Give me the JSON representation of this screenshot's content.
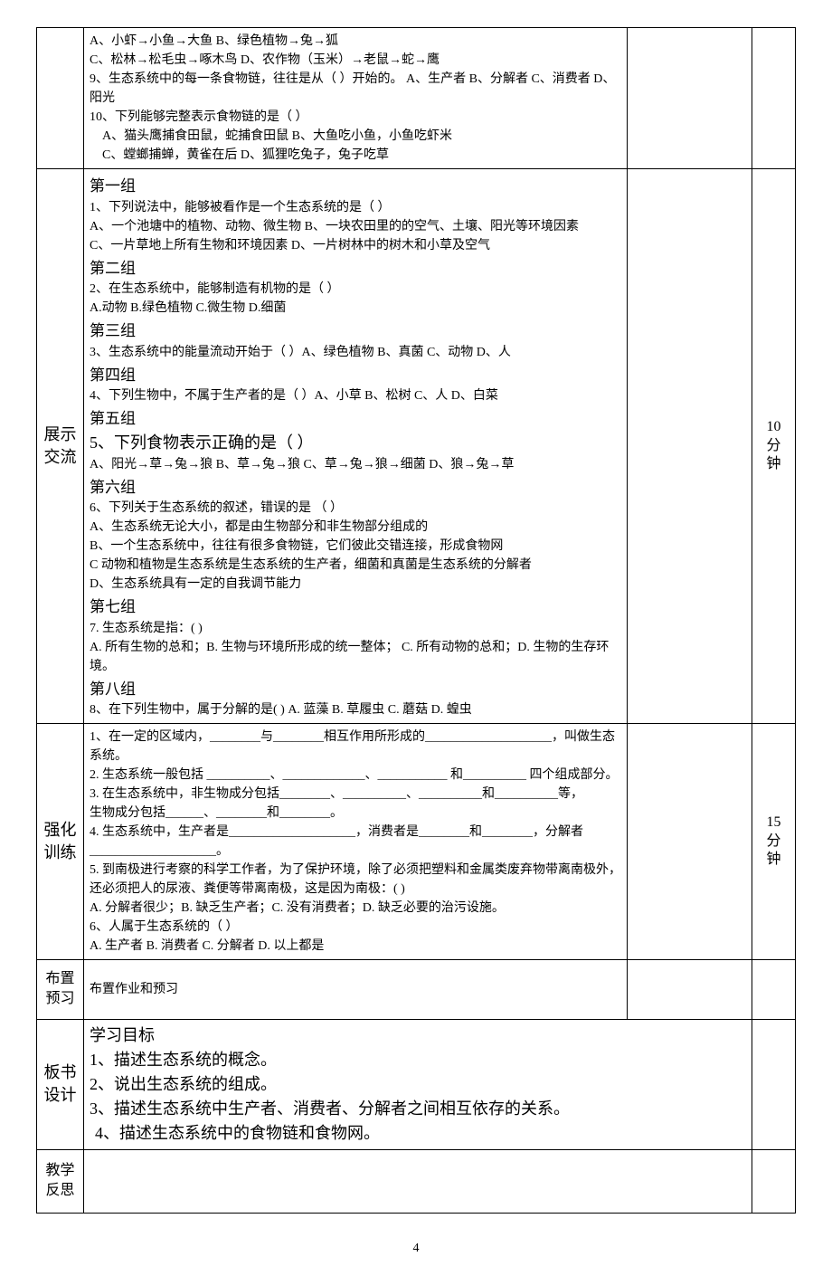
{
  "top_block": {
    "q_a": "A、小虾→小鱼→大鱼  B、绿色植物→兔→狐",
    "q_c": "C、松林→松毛虫→啄木鸟 D、农作物（玉米）→老鼠→蛇→鹰",
    "q9": "9、生态系统中的每一条食物链，往往是从（ ）开始的。   A、生产者   B、分解者   C、消费者   D、阳光",
    "q10_stem": "10、下列能够完整表示食物链的是（ ）",
    "q10_ab": "A、猫头鹰捕食田鼠，蛇捕食田鼠  B、大鱼吃小鱼，小鱼吃虾米",
    "q10_cd": "C、螳螂捕蝉，黄雀在后    D、狐狸吃兔子，兔子吃草"
  },
  "display": {
    "label_1": "展示",
    "label_2": "交流",
    "time_1": "10",
    "time_2": "分",
    "time_3": "钟",
    "g1": "第一组",
    "g1_q": "1、下列说法中，能够被看作是一个生态系统的是（ ）",
    "g1_a": "A、一个池塘中的植物、动物、微生物 B、一块农田里的的空气、土壤、阳光等环境因素",
    "g1_c": "C、一片草地上所有生物和环境因素 D、一片树林中的树木和小草及空气",
    "g2": "第二组",
    "g2_q": "2、在生态系统中，能够制造有机物的是（ ）",
    "g2_opts": "A.动物 B.绿色植物 C.微生物 D.细菌",
    "g3": "第三组",
    "g3_q": "3、生态系统中的能量流动开始于（ ）A、绿色植物   B、真菌   C、动物   D、人",
    "g4": "第四组",
    "g4_q": "4、下列生物中，不属于生产者的是（ ）A、小草   B、松树   C、人   D、白菜",
    "g5": "第五组",
    "g5_q": " 5、下列食物表示正确的是（    ）",
    "g5_opts": "A、阳光→草→兔→狼    B、草→兔→狼    C、草→兔→狼→细菌    D、狼→兔→草",
    "g6": "第六组",
    "g6_q": "6、下列关于生态系统的叙述，错误的是    （       ）",
    "g6_a": "A、生态系统无论大小，都是由生物部分和非生物部分组成的",
    "g6_b": "B、一个生态系统中，往往有很多食物链，它们彼此交错连接，形成食物网",
    "g6_c": "C 动物和植物是生态系统是生态系统的生产者，细菌和真菌是生态系统的分解者",
    "g6_d": "D、生态系统具有一定的自我调节能力",
    "g7": "第七组",
    "g7_q": "7. 生态系统是指：(         )",
    "g7_opts": "A. 所有生物的总和；B. 生物与环境所形成的统一整体；   C. 所有动物的总和；D. 生物的生存环境。",
    "g8": "第八组",
    "g8_q": "8、在下列生物中，属于分解的是(          )   A. 蓝藻   B. 草履虫   C. 蘑菇   D. 蝗虫"
  },
  "intensive": {
    "label_1": "强化",
    "label_2": "训练",
    "time_1": "15",
    "time_2": "分",
    "time_3": "钟",
    "q1": "1、在一定的区域内，________与________相互作用所形成的____________________，叫做生态系统。",
    "q2": "2. 生态系统一般包括  __________、_____________、___________ 和__________ 四个组成部分。",
    "q3_a": "3. 在生态系统中，非生物成分包括________、__________、__________和__________等，",
    "q3_b": "生物成分包括______、________和________。",
    "q4": "4. 生态系统中，生产者是____________________，消费者是________和________，分解者____________________。",
    "q5_a": "5. 到南极进行考察的科学工作者，为了保护环境，除了必须把塑料和金属类废弃物带离南极外，还必须把人的尿液、粪便等带离南极，这是因为南极：(          )",
    "q5_b": "A. 分解者很少；B. 缺乏生产者；C. 没有消费者；D. 缺乏必要的治污设施。",
    "q6": "6、人属于生态系统的（ ）",
    "q6_opts": "A. 生产者    B. 消费者    C. 分解者    D. 以上都是"
  },
  "homework": {
    "label_1": "布置",
    "label_2": "预习",
    "text": "布置作业和预习"
  },
  "board": {
    "label_1": "板书",
    "label_2": "设计",
    "h": "学习目标",
    "l1": "1、描述生态系统的概念。",
    "l2": "2、说出生态系统的组成。",
    "l3": "3、描述生态系统中生产者、消费者、分解者之间相互依存的关系。",
    "l4": "4、描述生态系统中的食物链和食物网。"
  },
  "reflection": {
    "label_1": "教学",
    "label_2": "反思"
  },
  "page_number": "4"
}
